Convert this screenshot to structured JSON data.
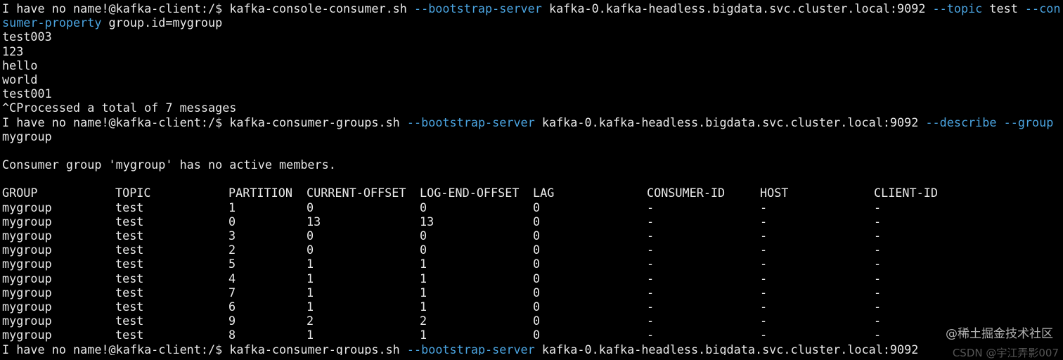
{
  "terminal": {
    "cmd1": {
      "prompt": "I have no name!@kafka-client:/$ ",
      "program": "kafka-console-consumer.sh ",
      "opt1": "--bootstrap-server",
      "arg1": " kafka-0.kafka-headless.bigdata.svc.cluster.local:9092 ",
      "opt2": "--topic",
      "arg2": " test ",
      "opt3a": "--con",
      "opt3b": "sumer-property",
      "arg3": " group.id=mygroup"
    },
    "messages": [
      "test003",
      "123",
      "hello",
      "world",
      "test001"
    ],
    "processed": "^CProcessed a total of 7 messages",
    "cmd2": {
      "prompt": "I have no name!@kafka-client:/$ ",
      "program": "kafka-consumer-groups.sh ",
      "opt1": "--bootstrap-server",
      "arg1": " kafka-0.kafka-headless.bigdata.svc.cluster.local:9092 ",
      "opt2": "--describe",
      "sep": " ",
      "opt3": "--group",
      "arg3": "mygroup"
    },
    "notice": "Consumer group 'mygroup' has no active members.",
    "table": {
      "headers": [
        "GROUP",
        "TOPIC",
        "PARTITION",
        "CURRENT-OFFSET",
        "LOG-END-OFFSET",
        "LAG",
        "CONSUMER-ID",
        "HOST",
        "CLIENT-ID"
      ],
      "rows": [
        [
          "mygroup",
          "test",
          "1",
          "0",
          "0",
          "0",
          "-",
          "-",
          "-"
        ],
        [
          "mygroup",
          "test",
          "0",
          "13",
          "13",
          "0",
          "-",
          "-",
          "-"
        ],
        [
          "mygroup",
          "test",
          "3",
          "0",
          "0",
          "0",
          "-",
          "-",
          "-"
        ],
        [
          "mygroup",
          "test",
          "2",
          "0",
          "0",
          "0",
          "-",
          "-",
          "-"
        ],
        [
          "mygroup",
          "test",
          "5",
          "1",
          "1",
          "0",
          "-",
          "-",
          "-"
        ],
        [
          "mygroup",
          "test",
          "4",
          "1",
          "1",
          "0",
          "-",
          "-",
          "-"
        ],
        [
          "mygroup",
          "test",
          "7",
          "1",
          "1",
          "0",
          "-",
          "-",
          "-"
        ],
        [
          "mygroup",
          "test",
          "6",
          "1",
          "1",
          "0",
          "-",
          "-",
          "-"
        ],
        [
          "mygroup",
          "test",
          "9",
          "2",
          "2",
          "0",
          "-",
          "-",
          "-"
        ],
        [
          "mygroup",
          "test",
          "8",
          "1",
          "1",
          "0",
          "-",
          "-",
          "-"
        ]
      ]
    },
    "cmd3": {
      "prompt": "I have no name!@kafka-client:/$ ",
      "program": "kafka-consumer-groups.sh ",
      "opt1": "--bootstrap-server",
      "arg1": " kafka-0.kafka-headless.bigdata.svc.cluster.local:9092"
    }
  },
  "watermark": "@稀土掘金技术社区",
  "watermark2": "CSDN @宇江弄影007",
  "colors": {
    "background": "#000000",
    "text": "#e8e8e8",
    "option": "#4aa3df"
  }
}
